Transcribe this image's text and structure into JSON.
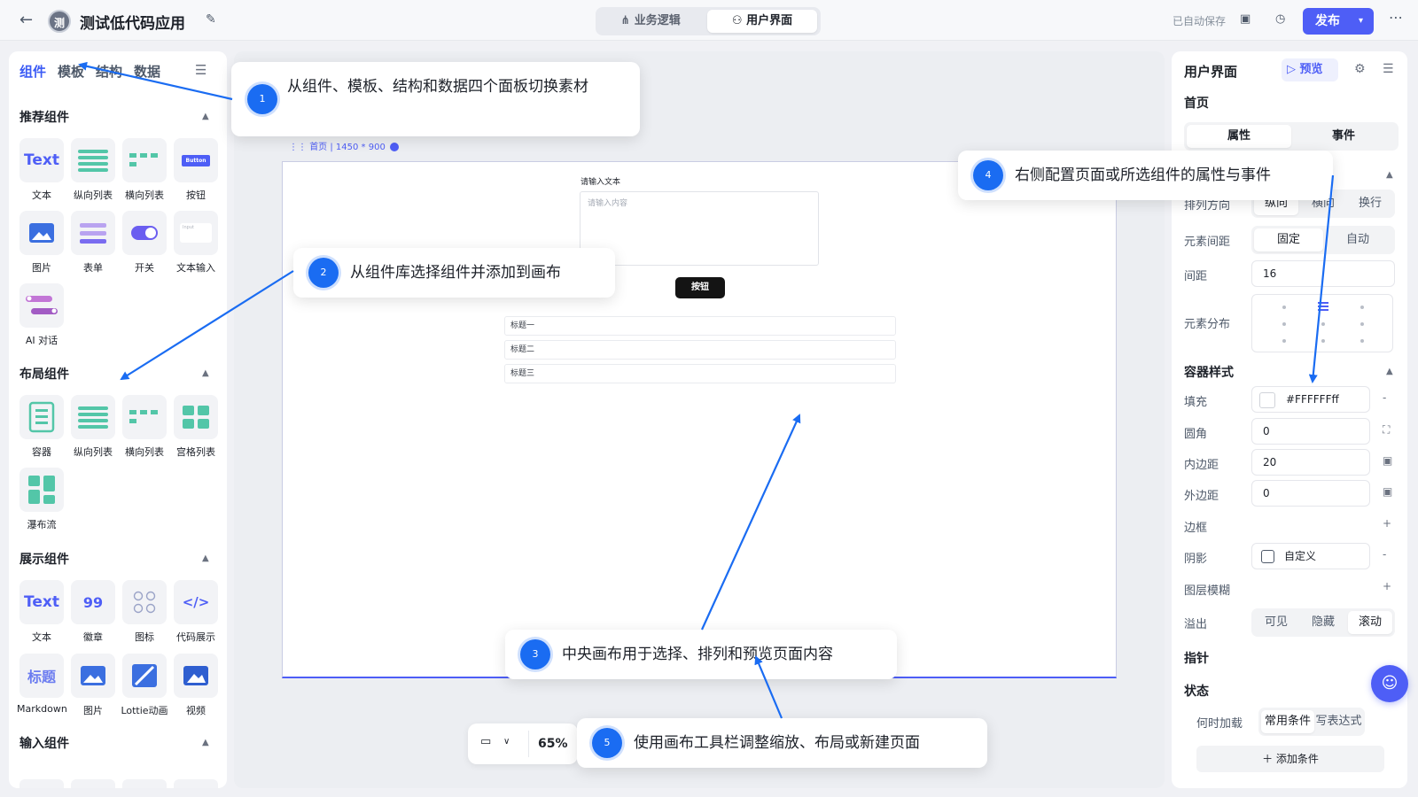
{
  "header": {
    "app_logo": "测",
    "app_title": "测试低代码应用",
    "tab_logic": "业务逻辑",
    "tab_ui": "用户界面",
    "saved_status": "已自动保存",
    "publish": "发布"
  },
  "left_panel": {
    "tabs": [
      "组件",
      "模板",
      "结构",
      "数据"
    ],
    "sections": [
      {
        "title": "推荐组件",
        "items": [
          {
            "label": "文本",
            "glyph": "Text"
          },
          {
            "label": "纵向列表"
          },
          {
            "label": "横向列表"
          },
          {
            "label": "按钮",
            "glyph": "Button"
          },
          {
            "label": "图片"
          },
          {
            "label": "表单"
          },
          {
            "label": "开关"
          },
          {
            "label": "文本输入",
            "glyph": "Input"
          },
          {
            "label": "AI 对话"
          }
        ]
      },
      {
        "title": "布局组件",
        "items": [
          {
            "label": "容器"
          },
          {
            "label": "纵向列表"
          },
          {
            "label": "横向列表"
          },
          {
            "label": "宫格列表"
          },
          {
            "label": "瀑布流"
          }
        ]
      },
      {
        "title": "展示组件",
        "items": [
          {
            "label": "文本",
            "glyph": "Text"
          },
          {
            "label": "徽章",
            "glyph": "99"
          },
          {
            "label": "图标"
          },
          {
            "label": "代码展示",
            "glyph": "</>"
          },
          {
            "label": "Markdown",
            "glyph": "标题"
          },
          {
            "label": "图片"
          },
          {
            "label": "Lottie动画"
          },
          {
            "label": "视频"
          }
        ]
      },
      {
        "title": "输入组件",
        "items": []
      }
    ]
  },
  "canvas": {
    "page_name": "首页",
    "page_size": "1450 * 900",
    "text_label": "请输入文本",
    "textarea_placeholder": "请输入内容",
    "button_label": "按钮",
    "list_items": [
      "标题一",
      "标题二",
      "标题三"
    ],
    "zoom": "65%"
  },
  "right_panel": {
    "title": "用户界面",
    "preview": "预览",
    "page_name": "首页",
    "tabs": [
      "属性",
      "事件"
    ],
    "direction": {
      "label": "排列方向",
      "options": [
        "纵向",
        "横向",
        "换行"
      ],
      "selected": "纵向"
    },
    "spacing_mode": {
      "label": "元素间距",
      "options": [
        "固定",
        "自动"
      ],
      "selected": "固定"
    },
    "gap": {
      "label": "间距",
      "value": "16"
    },
    "distribution": {
      "label": "元素分布"
    },
    "container_style_title": "容器样式",
    "fill": {
      "label": "填充",
      "value": "#FFFFFFff"
    },
    "radius": {
      "label": "圆角",
      "value": "0"
    },
    "padding": {
      "label": "内边距",
      "value": "20"
    },
    "margin": {
      "label": "外边距",
      "value": "0"
    },
    "border": {
      "label": "边框"
    },
    "shadow": {
      "label": "阴影",
      "value": "自定义"
    },
    "blur": {
      "label": "图层模糊"
    },
    "overflow": {
      "label": "溢出",
      "options": [
        "可见",
        "隐藏",
        "滚动"
      ],
      "selected": "滚动"
    },
    "pointer_title": "指针",
    "state_title": "状态",
    "load_when": {
      "label": "何时加载",
      "options": [
        "常用条件",
        "写表达式"
      ],
      "selected": "常用条件"
    },
    "add_condition": "添加条件"
  },
  "callouts": [
    {
      "num": "1",
      "text": "从组件、模板、结构和数据四个面板切换素材"
    },
    {
      "num": "2",
      "text": "从组件库选择组件并添加到画布"
    },
    {
      "num": "3",
      "text": "中央画布用于选择、排列和预览页面内容"
    },
    {
      "num": "4",
      "text": "右侧配置页面或所选组件的属性与事件"
    },
    {
      "num": "5",
      "text": "使用画布工具栏调整缩放、布局或新建页面"
    }
  ],
  "colors": {
    "accent": "#4e5ef6",
    "callout_blue": "#1a6cf2",
    "teal": "#53c6a8"
  }
}
